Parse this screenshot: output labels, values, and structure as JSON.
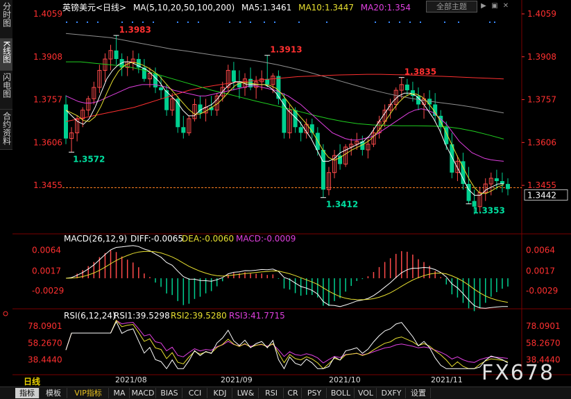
{
  "side_tabs": [
    "分时图",
    "K线图",
    "闪电图",
    "合约资料"
  ],
  "header": {
    "symbol": "英镑美元<日线>",
    "ma_label": "MA(5,10,20,50,100,200)",
    "ma5": "MA5:1.3461",
    "ma10": "MA10:1.3447",
    "ma20": "MA20:1.354",
    "theme_button": "全部主题",
    "win_buttons": [
      "▶",
      "▣",
      "✕"
    ]
  },
  "colors": {
    "up": "#ff4a4a",
    "down": "#00d090",
    "ma5": "#ffffff",
    "ma10": "#e8e030",
    "ma20": "#e040e0",
    "ma50": "#20d020",
    "ma100": "#909090",
    "ma200": "#ff3030",
    "axis_text": "#ff3030",
    "macd_dif": "#ffffff",
    "macd_dea": "#e8e030",
    "rsi1": "#ffffff",
    "rsi2": "#e8e030",
    "rsi3": "#e040e0",
    "price_line": "#ff8020"
  },
  "price_axis_ticks": [
    "1.4059",
    "1.3908",
    "1.3757",
    "1.3606",
    "1.3455"
  ],
  "current_price": "1.3442",
  "price_annotations": [
    {
      "text": "1.3983",
      "color": "#ff3030"
    },
    {
      "text": "1.3572",
      "color": "#00e0a0"
    },
    {
      "text": "1.3913",
      "color": "#ff3030"
    },
    {
      "text": "1.3412",
      "color": "#00e0a0"
    },
    {
      "text": "1.3835",
      "color": "#ff3030"
    },
    {
      "text": "1.3353",
      "color": "#00e0a0"
    }
  ],
  "macd": {
    "label": "MACD(26,12,9)",
    "dif": "DIFF:-0.0065",
    "dea": "DEA:-0.0060",
    "macd": "MACD:-0.0009",
    "ticks": [
      "0.0064",
      "0.0017",
      "-0.0029"
    ]
  },
  "rsi": {
    "label": "RSI(6,12,24)",
    "rsi1": "RSI1:39.5298",
    "rsi2": "RSI2:39.5280",
    "rsi3": "RSI3:41.7715",
    "ticks": [
      "78.0901",
      "58.2670",
      "38.4440"
    ]
  },
  "period_label": "日线",
  "x_months": [
    "2021/08",
    "2021/09",
    "2021/10",
    "2021/11"
  ],
  "brand": "FX678",
  "bottom_tabs": [
    "指标",
    "模板",
    "VIP指标",
    "MA",
    "MACD",
    "BIAS",
    "CCI",
    "KDJ",
    "LW&",
    "RSI",
    "CR",
    "PSY",
    "BOLL",
    "VOL",
    "DXFY",
    "设置"
  ],
  "chart_data": {
    "type": "candlestick",
    "price_range": [
      1.3338,
      1.4059
    ],
    "candles": [
      [
        1.374,
        1.3772,
        1.36,
        1.362
      ],
      [
        1.362,
        1.366,
        1.3572,
        1.364
      ],
      [
        1.364,
        1.37,
        1.361,
        1.369
      ],
      [
        1.369,
        1.373,
        1.366,
        1.372
      ],
      [
        1.372,
        1.377,
        1.37,
        1.376
      ],
      [
        1.376,
        1.382,
        1.374,
        1.38
      ],
      [
        1.38,
        1.388,
        1.378,
        1.386
      ],
      [
        1.386,
        1.392,
        1.382,
        1.39
      ],
      [
        1.39,
        1.395,
        1.386,
        1.393
      ],
      [
        1.393,
        1.3983,
        1.388,
        1.39
      ],
      [
        1.39,
        1.392,
        1.384,
        1.387
      ],
      [
        1.387,
        1.391,
        1.384,
        1.389
      ],
      [
        1.389,
        1.393,
        1.386,
        1.39
      ],
      [
        1.39,
        1.392,
        1.385,
        1.387
      ],
      [
        1.387,
        1.39,
        1.382,
        1.383
      ],
      [
        1.383,
        1.387,
        1.38,
        1.385
      ],
      [
        1.385,
        1.387,
        1.378,
        1.38
      ],
      [
        1.38,
        1.384,
        1.376,
        1.379
      ],
      [
        1.379,
        1.381,
        1.37,
        1.372
      ],
      [
        1.372,
        1.378,
        1.37,
        1.376
      ],
      [
        1.376,
        1.377,
        1.364,
        1.366
      ],
      [
        1.366,
        1.37,
        1.362,
        1.364
      ],
      [
        1.364,
        1.37,
        1.363,
        1.369
      ],
      [
        1.369,
        1.376,
        1.368,
        1.374
      ],
      [
        1.374,
        1.377,
        1.369,
        1.371
      ],
      [
        1.371,
        1.376,
        1.368,
        1.373
      ],
      [
        1.373,
        1.377,
        1.37,
        1.372
      ],
      [
        1.372,
        1.378,
        1.37,
        1.377
      ],
      [
        1.377,
        1.382,
        1.375,
        1.38
      ],
      [
        1.38,
        1.388,
        1.379,
        1.386
      ],
      [
        1.386,
        1.389,
        1.379,
        1.382
      ],
      [
        1.382,
        1.386,
        1.376,
        1.38
      ],
      [
        1.38,
        1.385,
        1.377,
        1.383
      ],
      [
        1.383,
        1.387,
        1.379,
        1.38
      ],
      [
        1.38,
        1.384,
        1.376,
        1.382
      ],
      [
        1.382,
        1.386,
        1.379,
        1.383
      ],
      [
        1.383,
        1.3913,
        1.38,
        1.381
      ],
      [
        1.381,
        1.385,
        1.378,
        1.384
      ],
      [
        1.384,
        1.386,
        1.374,
        1.376
      ],
      [
        1.376,
        1.378,
        1.362,
        1.364
      ],
      [
        1.364,
        1.374,
        1.362,
        1.372
      ],
      [
        1.372,
        1.373,
        1.364,
        1.366
      ],
      [
        1.366,
        1.368,
        1.361,
        1.364
      ],
      [
        1.364,
        1.369,
        1.362,
        1.367
      ],
      [
        1.367,
        1.369,
        1.362,
        1.364
      ],
      [
        1.364,
        1.366,
        1.356,
        1.358
      ],
      [
        1.358,
        1.36,
        1.3412,
        1.344
      ],
      [
        1.344,
        1.352,
        1.342,
        1.35
      ],
      [
        1.35,
        1.358,
        1.348,
        1.356
      ],
      [
        1.356,
        1.36,
        1.351,
        1.353
      ],
      [
        1.353,
        1.36,
        1.352,
        1.359
      ],
      [
        1.359,
        1.362,
        1.356,
        1.36
      ],
      [
        1.36,
        1.364,
        1.358,
        1.361
      ],
      [
        1.361,
        1.363,
        1.356,
        1.358
      ],
      [
        1.358,
        1.362,
        1.355,
        1.36
      ],
      [
        1.36,
        1.366,
        1.359,
        1.364
      ],
      [
        1.364,
        1.37,
        1.362,
        1.368
      ],
      [
        1.368,
        1.374,
        1.366,
        1.372
      ],
      [
        1.372,
        1.376,
        1.369,
        1.374
      ],
      [
        1.374,
        1.38,
        1.372,
        1.379
      ],
      [
        1.379,
        1.3835,
        1.376,
        1.381
      ],
      [
        1.381,
        1.383,
        1.377,
        1.379
      ],
      [
        1.379,
        1.382,
        1.375,
        1.377
      ],
      [
        1.377,
        1.38,
        1.372,
        1.374
      ],
      [
        1.374,
        1.378,
        1.369,
        1.376
      ],
      [
        1.376,
        1.379,
        1.372,
        1.374
      ],
      [
        1.374,
        1.378,
        1.368,
        1.37
      ],
      [
        1.37,
        1.372,
        1.364,
        1.366
      ],
      [
        1.366,
        1.368,
        1.358,
        1.36
      ],
      [
        1.36,
        1.364,
        1.348,
        1.35
      ],
      [
        1.35,
        1.356,
        1.347,
        1.354
      ],
      [
        1.354,
        1.357,
        1.344,
        1.346
      ],
      [
        1.346,
        1.352,
        1.339,
        1.34
      ],
      [
        1.34,
        1.344,
        1.3353,
        1.338
      ],
      [
        1.338,
        1.345,
        1.336,
        1.343
      ],
      [
        1.343,
        1.348,
        1.34,
        1.346
      ],
      [
        1.346,
        1.35,
        1.342,
        1.348
      ],
      [
        1.348,
        1.351,
        1.344,
        1.347
      ],
      [
        1.347,
        1.35,
        1.343,
        1.346
      ],
      [
        1.346,
        1.348,
        1.342,
        1.3442
      ]
    ],
    "ma_lines": {
      "ma5": [
        1.372,
        1.37,
        1.368,
        1.367,
        1.369,
        1.373,
        1.378,
        1.383,
        1.386,
        1.388,
        1.389,
        1.389,
        1.388,
        1.387,
        1.386,
        1.384,
        1.382,
        1.379,
        1.377,
        1.375,
        1.372,
        1.37,
        1.37,
        1.372,
        1.373,
        1.374,
        1.376,
        1.379,
        1.381,
        1.382,
        1.382,
        1.381,
        1.381,
        1.381,
        1.381,
        1.38,
        1.378,
        1.375,
        1.372,
        1.37,
        1.368,
        1.365,
        1.362,
        1.358,
        1.354,
        1.354,
        1.355,
        1.357,
        1.358,
        1.359,
        1.36,
        1.361,
        1.363,
        1.366,
        1.369,
        1.372,
        1.375,
        1.377,
        1.378,
        1.378,
        1.377,
        1.375,
        1.372,
        1.369,
        1.365,
        1.36,
        1.356,
        1.352,
        1.348,
        1.344,
        1.342,
        1.342,
        1.344,
        1.345,
        1.346,
        1.3461
      ],
      "ma20": [
        1.377,
        1.376,
        1.375,
        1.3745,
        1.3745,
        1.375,
        1.376,
        1.377,
        1.378,
        1.379,
        1.38,
        1.3805,
        1.381,
        1.381,
        1.381,
        1.3805,
        1.38,
        1.379,
        1.3785,
        1.378,
        1.3775,
        1.377,
        1.377,
        1.3775,
        1.378,
        1.3785,
        1.379,
        1.3795,
        1.38,
        1.3805,
        1.3805,
        1.38,
        1.3795,
        1.379,
        1.378,
        1.377,
        1.3755,
        1.374,
        1.372,
        1.37,
        1.368,
        1.366,
        1.364,
        1.363,
        1.362,
        1.3615,
        1.3615,
        1.362,
        1.3625,
        1.3635,
        1.365,
        1.3665,
        1.368,
        1.3695,
        1.371,
        1.372,
        1.3725,
        1.372,
        1.371,
        1.369,
        1.367,
        1.364,
        1.361,
        1.359,
        1.357,
        1.356,
        1.355,
        1.3545,
        1.3542,
        1.354
      ],
      "ma200": [
        1.368,
        1.369,
        1.37,
        1.371,
        1.372,
        1.373,
        1.3745,
        1.376,
        1.3775,
        1.379,
        1.38,
        1.3808,
        1.3815,
        1.382,
        1.3825,
        1.383,
        1.3834,
        1.3838,
        1.384,
        1.3842,
        1.3844,
        1.3845,
        1.3846,
        1.3846,
        1.3845,
        1.3844,
        1.3842,
        1.384,
        1.3838,
        1.3836,
        1.3834,
        1.3832,
        1.383
      ],
      "ma100": [
        1.399,
        1.3985,
        1.398,
        1.3975,
        1.3965,
        1.3955,
        1.3945,
        1.3935,
        1.3928,
        1.392,
        1.3912,
        1.3905,
        1.3898,
        1.389,
        1.388,
        1.3868,
        1.3855,
        1.384,
        1.3825,
        1.381,
        1.3795,
        1.3782,
        1.377,
        1.376,
        1.3752,
        1.3745,
        1.3738,
        1.373,
        1.372,
        1.371
      ],
      "ma50": [
        1.389,
        1.389,
        1.3885,
        1.388,
        1.3875,
        1.3865,
        1.385,
        1.3835,
        1.382,
        1.3805,
        1.379,
        1.3778,
        1.3765,
        1.3752,
        1.374,
        1.3728,
        1.3715,
        1.3702,
        1.369,
        1.368,
        1.3672,
        1.3668,
        1.3666,
        1.3665,
        1.3665,
        1.3664,
        1.3662,
        1.3655,
        1.3645,
        1.3632,
        1.3618
      ]
    }
  }
}
